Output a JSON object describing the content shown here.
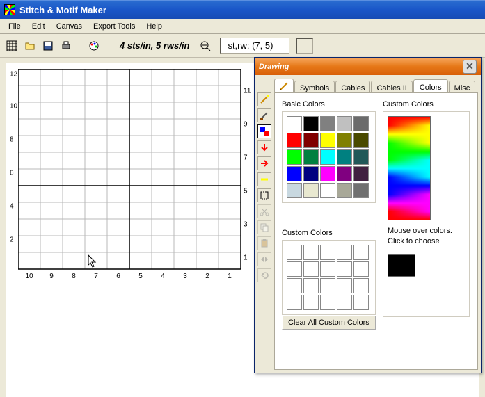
{
  "app": {
    "title": "Stitch & Motif Maker"
  },
  "menu": {
    "file": "File",
    "edit": "Edit",
    "canvas": "Canvas",
    "export": "Export Tools",
    "help": "Help"
  },
  "toolbar": {
    "gauge_text": "4 sts/in, 5 rws/in",
    "position_text": "st,rw: (7, 5)"
  },
  "grid": {
    "cols": 10,
    "rows": 12,
    "xlabels": [
      "10",
      "9",
      "8",
      "7",
      "6",
      "5",
      "4",
      "3",
      "2",
      "1"
    ],
    "ylabels_left": [
      "12",
      "10",
      "8",
      "6",
      "4",
      "2"
    ],
    "ylabels_right": [
      "11",
      "9",
      "7",
      "5",
      "3",
      "1"
    ]
  },
  "drawing": {
    "title": "Drawing",
    "tabs": {
      "symbols": "Symbols",
      "cables": "Cables",
      "cables2": "Cables II",
      "colors": "Colors",
      "misc": "Misc"
    },
    "basic_label": "Basic Colors",
    "basic_colors": [
      "#ffffff",
      "#000000",
      "#808080",
      "#c0c0c0",
      "#6b6b6b",
      "#ff0000",
      "#800000",
      "#ffff00",
      "#808000",
      "#4a4a00",
      "#00ff00",
      "#008040",
      "#00ffff",
      "#008080",
      "#205858",
      "#0000ff",
      "#000080",
      "#ff00ff",
      "#800080",
      "#402040",
      "#c8d8e0",
      "#e8e8d0",
      "#ffffff",
      "#a8a898",
      "#707070"
    ],
    "custom_slots_label": "Custom Colors",
    "custom_picker_label": "Custom Colors",
    "picker_help": "Mouse over colors. Click to choose",
    "clear_label": "Clear All Custom Colors"
  }
}
